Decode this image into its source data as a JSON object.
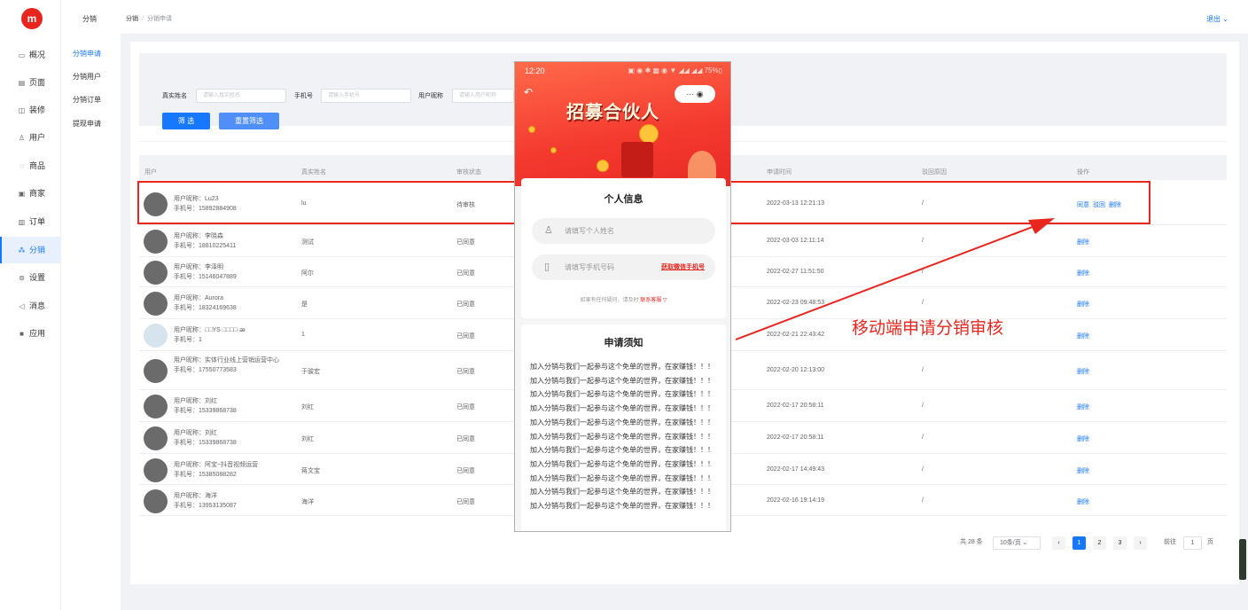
{
  "logo": "m",
  "sidebar": [
    {
      "label": "概况",
      "icon": "dashboard-icon",
      "glyph": "▭"
    },
    {
      "label": "页面",
      "icon": "page-icon",
      "glyph": "▤"
    },
    {
      "label": "装修",
      "icon": "decorate-icon",
      "glyph": "◫"
    },
    {
      "label": "用户",
      "icon": "user-icon",
      "glyph": "♙"
    },
    {
      "label": "商品",
      "icon": "product-icon",
      "glyph": "◌"
    },
    {
      "label": "商家",
      "icon": "store-icon",
      "glyph": "▣"
    },
    {
      "label": "订单",
      "icon": "order-icon",
      "glyph": "▥"
    },
    {
      "label": "分销",
      "icon": "distribution-icon",
      "glyph": "⁂",
      "active": true
    },
    {
      "label": "设置",
      "icon": "settings-icon",
      "glyph": "⊚"
    },
    {
      "label": "消息",
      "icon": "message-icon",
      "glyph": "◁"
    },
    {
      "label": "应用",
      "icon": "apps-icon",
      "glyph": "■"
    }
  ],
  "subnav": {
    "title": "分销",
    "items": [
      {
        "label": "分销申请",
        "active": true
      },
      {
        "label": "分销用户"
      },
      {
        "label": "分销订单"
      },
      {
        "label": "提现申请"
      }
    ]
  },
  "header": {
    "crumb_root": "分销",
    "crumb_sep": "/",
    "crumb_current": "分销申请",
    "logout": "退出 ⌄"
  },
  "filter": {
    "real_name_label": "真实姓名",
    "real_name_placeholder": "请输入真实姓名",
    "phone_label": "手机号",
    "phone_placeholder": "请输入手机号",
    "nickname_label": "用户昵称",
    "nickname_placeholder": "请输入用户昵称",
    "search_btn": "筛 选",
    "reset_btn": "重置筛选"
  },
  "table": {
    "headers": {
      "user": "用户",
      "real_name": "真实姓名",
      "status": "审核状态",
      "apply_time": "申请时间",
      "reject_reason": "驳回原因",
      "ops": "操作"
    },
    "rows": [
      {
        "nickname": "用户昵称：Lu23",
        "phone": "手机号：15892884908",
        "real_name": "lu",
        "status": "待审核",
        "time": "2022-03-13 12:21:13",
        "reason": "/",
        "ops": [
          "同意",
          "驳回",
          "删除"
        ]
      },
      {
        "nickname": "用户昵称：李晓森",
        "phone": "手机号：18810225411",
        "real_name": "测试",
        "status": "已同意",
        "time": "2022-03-03 12:11:14",
        "reason": "/",
        "ops": [
          "删除"
        ]
      },
      {
        "nickname": "用户昵称：李泽明",
        "phone": "手机号：15146047889",
        "real_name": "阿尔",
        "status": "已同意",
        "time": "2022-02-27 11:51:50",
        "reason": "/",
        "ops": [
          "删除"
        ]
      },
      {
        "nickname": "用户昵称：Aurora",
        "phone": "手机号：18324169638",
        "real_name": "是",
        "status": "已同意",
        "time": "2022-02-23 09:48:53",
        "reason": "/",
        "ops": [
          "删除"
        ]
      },
      {
        "nickname": "用户昵称：□□YS □□□□·ꭂ",
        "phone": "手机号：1",
        "real_name": "1",
        "status": "已同意",
        "time": "2022-02-21 22:43:42",
        "reason": "/",
        "ops": [
          "删除"
        ]
      },
      {
        "nickname": "用户昵称：实体行业线上营销运营中心",
        "phone": "手机号：17550773583",
        "real_name": "于骏宏",
        "status": "已同意",
        "time": "2022-02-20 12:13:00",
        "reason": "/",
        "ops": [
          "删除"
        ]
      },
      {
        "nickname": "用户昵称：刘红",
        "phone": "手机号：15339868738",
        "real_name": "刘红",
        "status": "已同意",
        "time": "2022-02-17 20:58:11",
        "reason": "/",
        "ops": [
          "删除"
        ]
      },
      {
        "nickname": "用户昵称：刘红",
        "phone": "手机号：15339868738",
        "real_name": "刘红",
        "status": "已同意",
        "time": "2022-02-17 20:58:11",
        "reason": "/",
        "ops": [
          "删除"
        ]
      },
      {
        "nickname": "用户昵称：阿宝~抖音视频运营",
        "phone": "手机号：15385088282",
        "real_name": "蒋文宝",
        "status": "已同意",
        "time": "2022-02-17 14:49:43",
        "reason": "/",
        "ops": [
          "删除"
        ]
      },
      {
        "nickname": "用户昵称：海洋",
        "phone": "手机号：13953135087",
        "real_name": "海洋",
        "status": "已同意",
        "time": "2022-02-16 19:14:19",
        "reason": "/",
        "ops": [
          "删除"
        ]
      }
    ]
  },
  "pagination": {
    "total": "共 28 条",
    "page_size": "10条/页 ⌄",
    "prev": "‹",
    "pages": [
      "1",
      "2",
      "3"
    ],
    "next": "›",
    "goto": "前往",
    "goto_value": "1",
    "page_unit": "页"
  },
  "phone": {
    "time": "12:20",
    "status": "▣ ◉ ✱ ▩ ◉ ▼ ◢◢ ◢◢ 75%▯",
    "back": "↶",
    "capsule": "··· ◉",
    "banner_title": "招募合伙人",
    "info_title": "个人信息",
    "name_placeholder": "请填写个人姓名",
    "phone_placeholder": "请填写手机号码",
    "get_phone": "获取微信手机号",
    "help_text": "如果有任何疑问，请及时",
    "help_link": "联系客服 ▽",
    "notice_title": "申请须知",
    "notice_body": "加入分销与我们一起参与这个免单的世界，在家赚钱！！！加入分销与我们一起参与这个免单的世界，在家赚钱！！！加入分销与我们一起参与这个免单的世界，在家赚钱！！！加入分销与我们一起参与这个免单的世界，在家赚钱！！！加入分销与我们一起参与这个免单的世界，在家赚钱！！！加入分销与我们一起参与这个免单的世界，在家赚钱！！！加入分销与我们一起参与这个免单的世界，在家赚钱！！！加入分销与我们一起参与这个免单的世界，在家赚钱！！！加入分销与我们一起参与这个免单的世界，在家赚钱！！！加入分销与我们一起参与这个免单的世界，在家赚钱！！！加入分销与我们一起参与这个免单的世界，在家赚钱！！！"
  },
  "annotation": "移动端申请分销审核",
  "colors": {
    "accent": "#1677ff",
    "highlight": "#e8261e"
  }
}
